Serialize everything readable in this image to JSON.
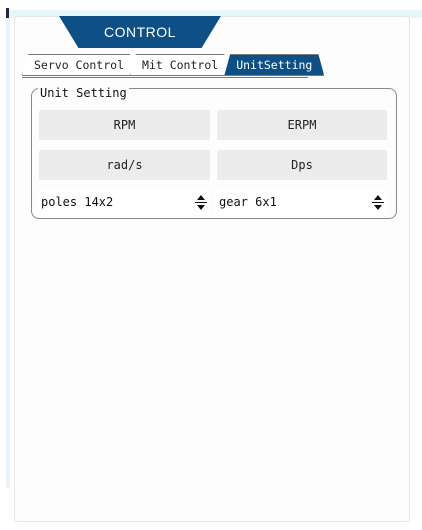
{
  "header": {
    "title": "CONTROL"
  },
  "tabs": [
    {
      "label": "Servo Control"
    },
    {
      "label": "Mit Control"
    },
    {
      "label": "UnitSetting"
    }
  ],
  "unit_setting": {
    "title": "Unit Setting",
    "buttons": [
      "RPM",
      "ERPM",
      "rad/s",
      "Dps"
    ],
    "poles": {
      "value": "poles 14x2"
    },
    "gear": {
      "value": "gear 6x1"
    }
  },
  "colors": {
    "accent": "#0e4f86",
    "button_bg": "#ececec",
    "top_strip": "#e6f7fb"
  },
  "icons": [
    "up-arrow-icon",
    "down-arrow-icon"
  ]
}
